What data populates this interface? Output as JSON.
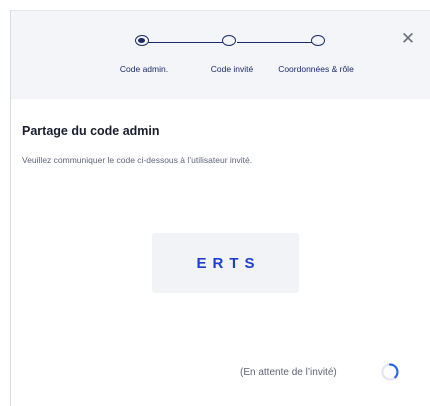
{
  "stepper": {
    "steps": [
      {
        "label": "Code admin.",
        "state": "active"
      },
      {
        "label": "Code invité",
        "state": "pending"
      },
      {
        "label": "Coordonnées & rôle",
        "state": "pending"
      }
    ]
  },
  "dialog": {
    "close_icon": "close-icon",
    "title": "Partage du code admin",
    "subtitle": "Veuillez communiquer le code ci-dessous à l’utilisateur invité.",
    "code": "ERTS",
    "waiting_text": "(En attente de l’invité)"
  },
  "colors": {
    "accent": "#1d3fd1",
    "navy": "#1c2a6b",
    "header_bg": "#f4f5f9",
    "code_bg": "#f2f3f7"
  }
}
